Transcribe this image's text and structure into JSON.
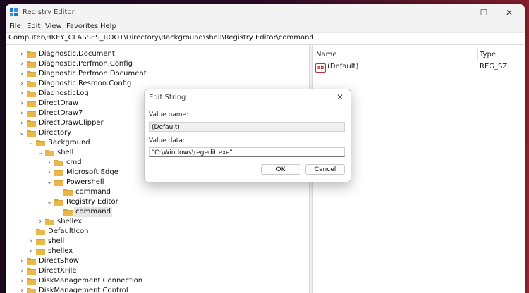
{
  "window": {
    "title": "Registry Editor",
    "controls": {
      "minimize": "–",
      "maximize": "☐",
      "close": "✕"
    }
  },
  "menu": [
    "File",
    "Edit",
    "View",
    "Favorites",
    "Help"
  ],
  "address": "Computer\\HKEY_CLASSES_ROOT\\Directory\\Background\\shell\\Registry Editor\\command",
  "tree": [
    {
      "label": "Diagnostic.Document",
      "depth": 0,
      "expander": "collapsed"
    },
    {
      "label": "Diagnostic.Perfmon.Config",
      "depth": 0,
      "expander": "collapsed"
    },
    {
      "label": "Diagnostic.Perfmon.Document",
      "depth": 0,
      "expander": "collapsed"
    },
    {
      "label": "Diagnostic.Resmon.Config",
      "depth": 0,
      "expander": "collapsed"
    },
    {
      "label": "DiagnosticLog",
      "depth": 0,
      "expander": "collapsed"
    },
    {
      "label": "DirectDraw",
      "depth": 0,
      "expander": "collapsed"
    },
    {
      "label": "DirectDraw7",
      "depth": 0,
      "expander": "collapsed"
    },
    {
      "label": "DirectDrawClipper",
      "depth": 0,
      "expander": "collapsed"
    },
    {
      "label": "Directory",
      "depth": 0,
      "expander": "expanded"
    },
    {
      "label": "Background",
      "depth": 1,
      "expander": "expanded"
    },
    {
      "label": "shell",
      "depth": 2,
      "expander": "expanded"
    },
    {
      "label": "cmd",
      "depth": 3,
      "expander": "collapsed"
    },
    {
      "label": "Microsoft Edge",
      "depth": 3,
      "expander": "collapsed"
    },
    {
      "label": "Powershell",
      "depth": 3,
      "expander": "expanded"
    },
    {
      "label": "command",
      "depth": 4,
      "expander": "none"
    },
    {
      "label": "Registry Editor",
      "depth": 3,
      "expander": "expanded"
    },
    {
      "label": "command",
      "depth": 4,
      "expander": "none",
      "selected": true
    },
    {
      "label": "shellex",
      "depth": 2,
      "expander": "collapsed"
    },
    {
      "label": "DefaultIcon",
      "depth": 1,
      "expander": "none"
    },
    {
      "label": "shell",
      "depth": 1,
      "expander": "collapsed"
    },
    {
      "label": "shellex",
      "depth": 1,
      "expander": "collapsed"
    },
    {
      "label": "DirectShow",
      "depth": 0,
      "expander": "collapsed"
    },
    {
      "label": "DirectXFile",
      "depth": 0,
      "expander": "collapsed"
    },
    {
      "label": "DiskManagement.Connection",
      "depth": 0,
      "expander": "collapsed"
    },
    {
      "label": "DiskManagement.Control",
      "depth": 0,
      "expander": "collapsed"
    }
  ],
  "values_pane": {
    "columns": {
      "name": "Name",
      "type": "Type"
    },
    "rows": [
      {
        "icon": "string-value-icon",
        "icon_text": "ab",
        "name": "(Default)",
        "type": "REG_SZ"
      }
    ]
  },
  "dialog": {
    "title": "Edit String",
    "value_name_label": "Value name:",
    "value_name": "(Default)",
    "value_data_label": "Value data:",
    "value_data": "\"C:\\Windows\\regedit.exe\"",
    "ok_label": "OK",
    "cancel_label": "Cancel"
  },
  "colors": {
    "folder": "#e8b84a",
    "folder_dark": "#d9a636",
    "selection": "#e5e5e5",
    "desktop": "#2a0c26"
  }
}
